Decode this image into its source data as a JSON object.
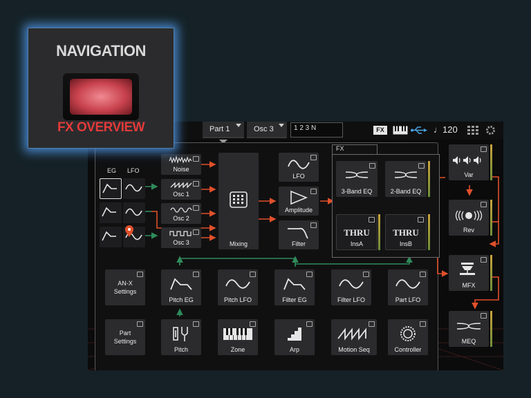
{
  "callout": {
    "title": "NAVIGATION",
    "subtitle": "FX OVERVIEW"
  },
  "topbar": {
    "tabs": [
      {
        "label": "Part 1"
      },
      {
        "label": "Osc 3"
      }
    ],
    "sequence": "1 2 3 N",
    "fx_badge": "FX",
    "tempo": "♩120"
  },
  "left_column": {
    "eg_label": "EG",
    "lfo_label": "LFO"
  },
  "blocks": {
    "noise": "Noise",
    "osc1": "Osc 1",
    "osc2": "Osc 2",
    "osc3": "Osc 3",
    "mixing": "Mixing",
    "lfo": "LFO",
    "amplitude": "Amplitude",
    "filter": "Filter",
    "anx_settings_1": "AN-X",
    "anx_settings_2": "Settings",
    "pitch_eg": "Pitch EG",
    "pitch_lfo": "Pitch LFO",
    "filter_eg": "Filter EG",
    "filter_lfo": "Filter LFO",
    "part_lfo": "Part LFO",
    "part_settings_1": "Part",
    "part_settings_2": "Settings",
    "pitch": "Pitch",
    "zone": "Zone",
    "arp": "Arp",
    "motion_seq": "Motion Seq",
    "controller": "Controller"
  },
  "fx": {
    "label": "FX",
    "band3": "3-Band EQ",
    "band2": "2-Band EQ",
    "insA_icon": "THRU",
    "insA": "InsA",
    "insB_icon": "THRU",
    "insB": "InsB",
    "var": "Var",
    "rev": "Rev",
    "mfx": "MFX",
    "meq": "MEQ"
  },
  "colors": {
    "signal": "#e0502a",
    "modulation": "#2f8a5a",
    "glow": "#5a9be6",
    "callout_red": "#e23a3a"
  }
}
